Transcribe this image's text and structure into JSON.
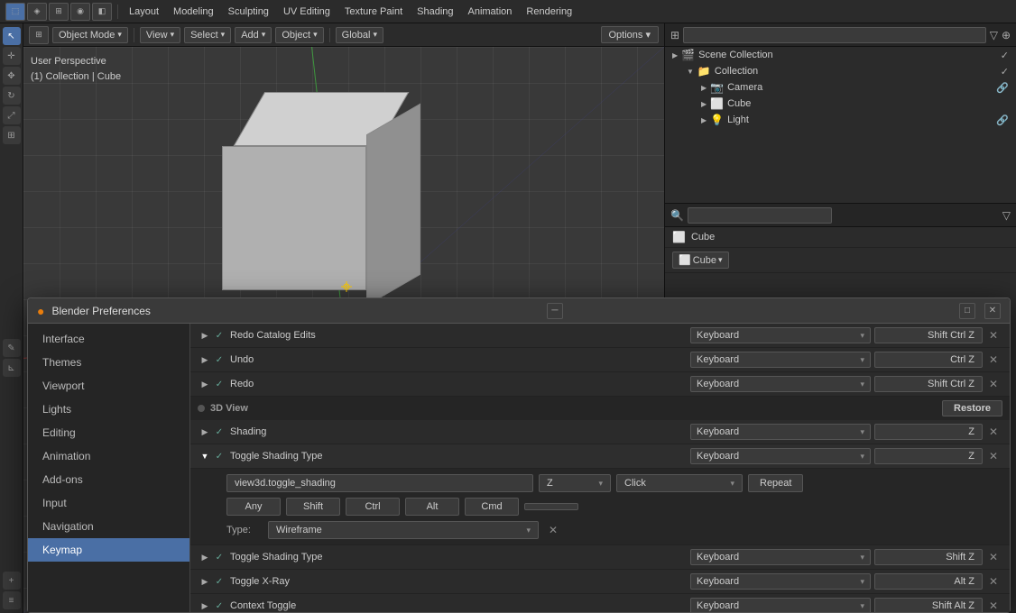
{
  "topbar": {
    "menus": [
      "Layout",
      "Modeling",
      "Sculpting",
      "UV Editing",
      "Texture Paint",
      "Shading",
      "Animation",
      "Rendering"
    ],
    "active_mode": "Layout",
    "global_label": "Global",
    "options_label": "Options"
  },
  "viewport": {
    "info_line1": "User Perspective",
    "info_line2": "(1) Collection | Cube"
  },
  "outliner": {
    "title": "Scene Collection",
    "items": [
      {
        "label": "Collection",
        "type": "collection",
        "indent": 1,
        "expanded": true
      },
      {
        "label": "Camera",
        "type": "camera",
        "indent": 2
      },
      {
        "label": "Cube",
        "type": "cube",
        "indent": 2
      },
      {
        "label": "Light",
        "type": "light",
        "indent": 2
      }
    ]
  },
  "properties": {
    "name1": "Cube",
    "name2": "Cube"
  },
  "prefs": {
    "title": "Blender Preferences",
    "nav_items": [
      "Interface",
      "Themes",
      "Viewport",
      "Lights",
      "Editing",
      "Animation",
      "Add-ons",
      "Input",
      "Navigation",
      "Keymap"
    ],
    "active_nav": "Keymap",
    "rows": [
      {
        "indent": 1,
        "expanded": false,
        "checked": true,
        "name": "Redo Catalog Edits",
        "kbd": "Keyboard",
        "shortcut": "Shift Ctrl Z",
        "has_x": true
      },
      {
        "indent": 1,
        "expanded": false,
        "checked": true,
        "name": "Undo",
        "kbd": "Keyboard",
        "shortcut": "Ctrl Z",
        "has_x": true
      },
      {
        "indent": 1,
        "expanded": false,
        "checked": true,
        "name": "Redo",
        "kbd": "Keyboard",
        "shortcut": "Shift Ctrl Z",
        "has_x": true
      }
    ],
    "section_3dview": "3D View",
    "section_restore": "Restore",
    "shading_rows": [
      {
        "indent": 1,
        "expanded": false,
        "checked": true,
        "name": "Shading",
        "kbd": "Keyboard",
        "shortcut": "Z",
        "has_x": true
      },
      {
        "indent": 1,
        "expanded": true,
        "checked": true,
        "name": "Toggle Shading Type",
        "kbd": "Keyboard",
        "shortcut": "Z",
        "has_x": true
      }
    ],
    "expanded_operator": "view3d.toggle_shading",
    "expanded_key": "Z",
    "expanded_event": "Click",
    "expanded_repeat": "Repeat",
    "expanded_any": "Any",
    "expanded_shift": "Shift",
    "expanded_ctrl": "Ctrl",
    "expanded_alt": "Alt",
    "expanded_cmd": "Cmd",
    "expanded_type_label": "Type:",
    "expanded_type_value": "Wireframe",
    "after_rows": [
      {
        "indent": 1,
        "expanded": false,
        "checked": true,
        "name": "Toggle Shading Type",
        "kbd": "Keyboard",
        "shortcut": "Shift Z",
        "has_x": true
      },
      {
        "indent": 1,
        "expanded": false,
        "checked": true,
        "name": "Toggle X-Ray",
        "kbd": "Keyboard",
        "shortcut": "Alt Z",
        "has_x": true
      },
      {
        "indent": 1,
        "expanded": false,
        "checked": true,
        "name": "Context Toggle",
        "kbd": "Keyboard",
        "shortcut": "Shift Alt Z",
        "has_x": true
      }
    ]
  }
}
